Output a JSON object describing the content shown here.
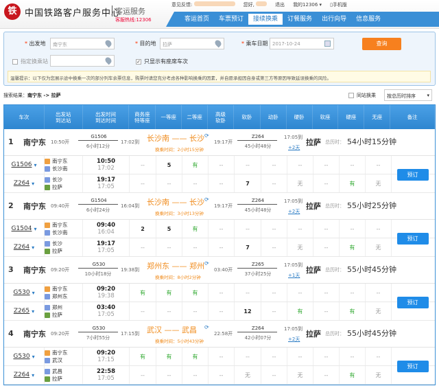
{
  "header": {
    "logo": "铁",
    "site_name": "中国铁路客户服务中心",
    "service": "客运服务",
    "hotline": "客服热线:12306",
    "feedback": "意见反馈:",
    "hello": "您好,",
    "logout": "退出",
    "my12306": "我的12306 ▾",
    "mobile": "手机版"
  },
  "nav": [
    {
      "label": "客运首页"
    },
    {
      "label": "车票预订"
    },
    {
      "label": "接续换乘",
      "active": true
    },
    {
      "label": "订餐服务"
    },
    {
      "label": "出行向导"
    },
    {
      "label": "信息服务"
    }
  ],
  "form": {
    "from_label": "出发地",
    "from_value": "南宁东",
    "to_label": "目的地",
    "to_value": "拉萨",
    "date_label": "乘车日期",
    "date_value": "2017-10-24",
    "query_button": "查询",
    "transfer_label": "指定换乘站",
    "seat_only_label": "只显示有座席车次",
    "seat_only_checked": true,
    "notice": "温馨提示：以下仅为您展示途中换乘一次的部分列车余票信息，购票时请您充分考虑各种影响换乘的因素，并自愿承担因自身或第三方等原因导致延误换乘的风险。"
  },
  "results": {
    "label": "搜索结果：",
    "route": "南宁东 -> 拉萨",
    "same_station": "同站换乘",
    "sort": "按总历时排序"
  },
  "columns": [
    "车次",
    "出发站\n到达站",
    "出发时间\n到达时间",
    "商务座\n特等座",
    "一等座",
    "二等座",
    "高级\n软卧",
    "软卧",
    "动卧",
    "硬卧",
    "软座",
    "硬座",
    "无座",
    "备注"
  ],
  "book_label": "预订",
  "total_label": "总历时：",
  "groups": [
    {
      "idx": "1",
      "from": "南宁东",
      "dep": "10:50开",
      "train1": "G1506",
      "dur1": "6小时12分",
      "arr1": "17:02到",
      "transfer": "长沙南 —— 长沙",
      "wait": "换乘时间：2小时15分钟",
      "dep2": "19:17开",
      "train2": "Z264",
      "dur2": "45小时48分",
      "arr": "17:05到",
      "plus": "+2天",
      "to": "拉萨",
      "total": "54小时15分钟",
      "legs": [
        {
          "train": "G1506",
          "from": "南宁东",
          "to": "长沙南",
          "dep": "10:50",
          "arr": "17:02",
          "seats": [
            "--",
            "5",
            "有",
            "--",
            "--",
            "--",
            "--",
            "--",
            "--",
            "--"
          ]
        },
        {
          "train": "Z264",
          "from": "长沙",
          "to": "拉萨",
          "dep": "19:17",
          "arr": "17:05",
          "seats": [
            "--",
            "--",
            "--",
            "--",
            "7",
            "--",
            "无",
            "--",
            "有",
            "无"
          ]
        }
      ]
    },
    {
      "idx": "2",
      "from": "南宁东",
      "dep": "09:40开",
      "train1": "G1504",
      "dur1": "6小时24分",
      "arr1": "16:04到",
      "transfer": "长沙南 —— 长沙",
      "wait": "换乘时间：3小时13分钟",
      "dep2": "19:17开",
      "train2": "Z264",
      "dur2": "45小时48分",
      "arr": "17:05到",
      "plus": "+2天",
      "to": "拉萨",
      "total": "55小时25分钟",
      "legs": [
        {
          "train": "G1504",
          "from": "南宁东",
          "to": "长沙南",
          "dep": "09:40",
          "arr": "16:04",
          "seats": [
            "2",
            "5",
            "有",
            "--",
            "--",
            "--",
            "--",
            "--",
            "--",
            "--"
          ]
        },
        {
          "train": "Z264",
          "from": "长沙",
          "to": "拉萨",
          "dep": "19:17",
          "arr": "17:05",
          "seats": [
            "--",
            "--",
            "--",
            "--",
            "7",
            "--",
            "无",
            "--",
            "有",
            "无"
          ]
        }
      ]
    },
    {
      "idx": "3",
      "from": "南宁东",
      "dep": "09:20开",
      "train1": "G530",
      "dur1": "10小时18分",
      "arr1": "19:38到",
      "transfer": "郑州东 —— 郑州",
      "wait": "换乘时间：8小时2分钟",
      "dep2": "03:40开",
      "train2": "Z265",
      "dur2": "37小时25分",
      "arr": "17:05到",
      "plus": "+1天",
      "to": "拉萨",
      "total": "55小时45分钟",
      "legs": [
        {
          "train": "G530",
          "from": "南宁东",
          "to": "郑州东",
          "dep": "09:20",
          "arr": "19:38",
          "seats": [
            "有",
            "有",
            "有",
            "--",
            "--",
            "--",
            "--",
            "--",
            "--",
            "--"
          ]
        },
        {
          "train": "Z265",
          "from": "郑州",
          "to": "拉萨",
          "dep": "03:40",
          "arr": "17:05",
          "seats": [
            "--",
            "--",
            "--",
            "--",
            "12",
            "--",
            "有",
            "--",
            "有",
            "无"
          ]
        }
      ]
    },
    {
      "idx": "4",
      "from": "南宁东",
      "dep": "09:20开",
      "train1": "G530",
      "dur1": "7小时55分",
      "arr1": "17:15到",
      "transfer": "武汉 —— 武昌",
      "wait": "换乘时间：5小时43分钟",
      "dep2": "22:58开",
      "train2": "Z264",
      "dur2": "42小时07分",
      "arr": "17:05到",
      "plus": "+2天",
      "to": "拉萨",
      "total": "55小时45分钟",
      "legs": [
        {
          "train": "G530",
          "from": "南宁东",
          "to": "武汉",
          "dep": "09:20",
          "arr": "17:15",
          "seats": [
            "有",
            "有",
            "有",
            "--",
            "--",
            "--",
            "--",
            "--",
            "--",
            "--"
          ]
        },
        {
          "train": "Z264",
          "from": "武昌",
          "to": "拉萨",
          "dep": "22:58",
          "arr": "17:05",
          "seats": [
            "--",
            "--",
            "--",
            "--",
            "无",
            "--",
            "无",
            "--",
            "有",
            "无"
          ]
        }
      ]
    }
  ],
  "colors": {
    "nav": "#3a8fd6",
    "accent": "#f7801e",
    "book": "#1f8ce8",
    "transfer": "#f08c1e",
    "available": "#33aa33"
  }
}
